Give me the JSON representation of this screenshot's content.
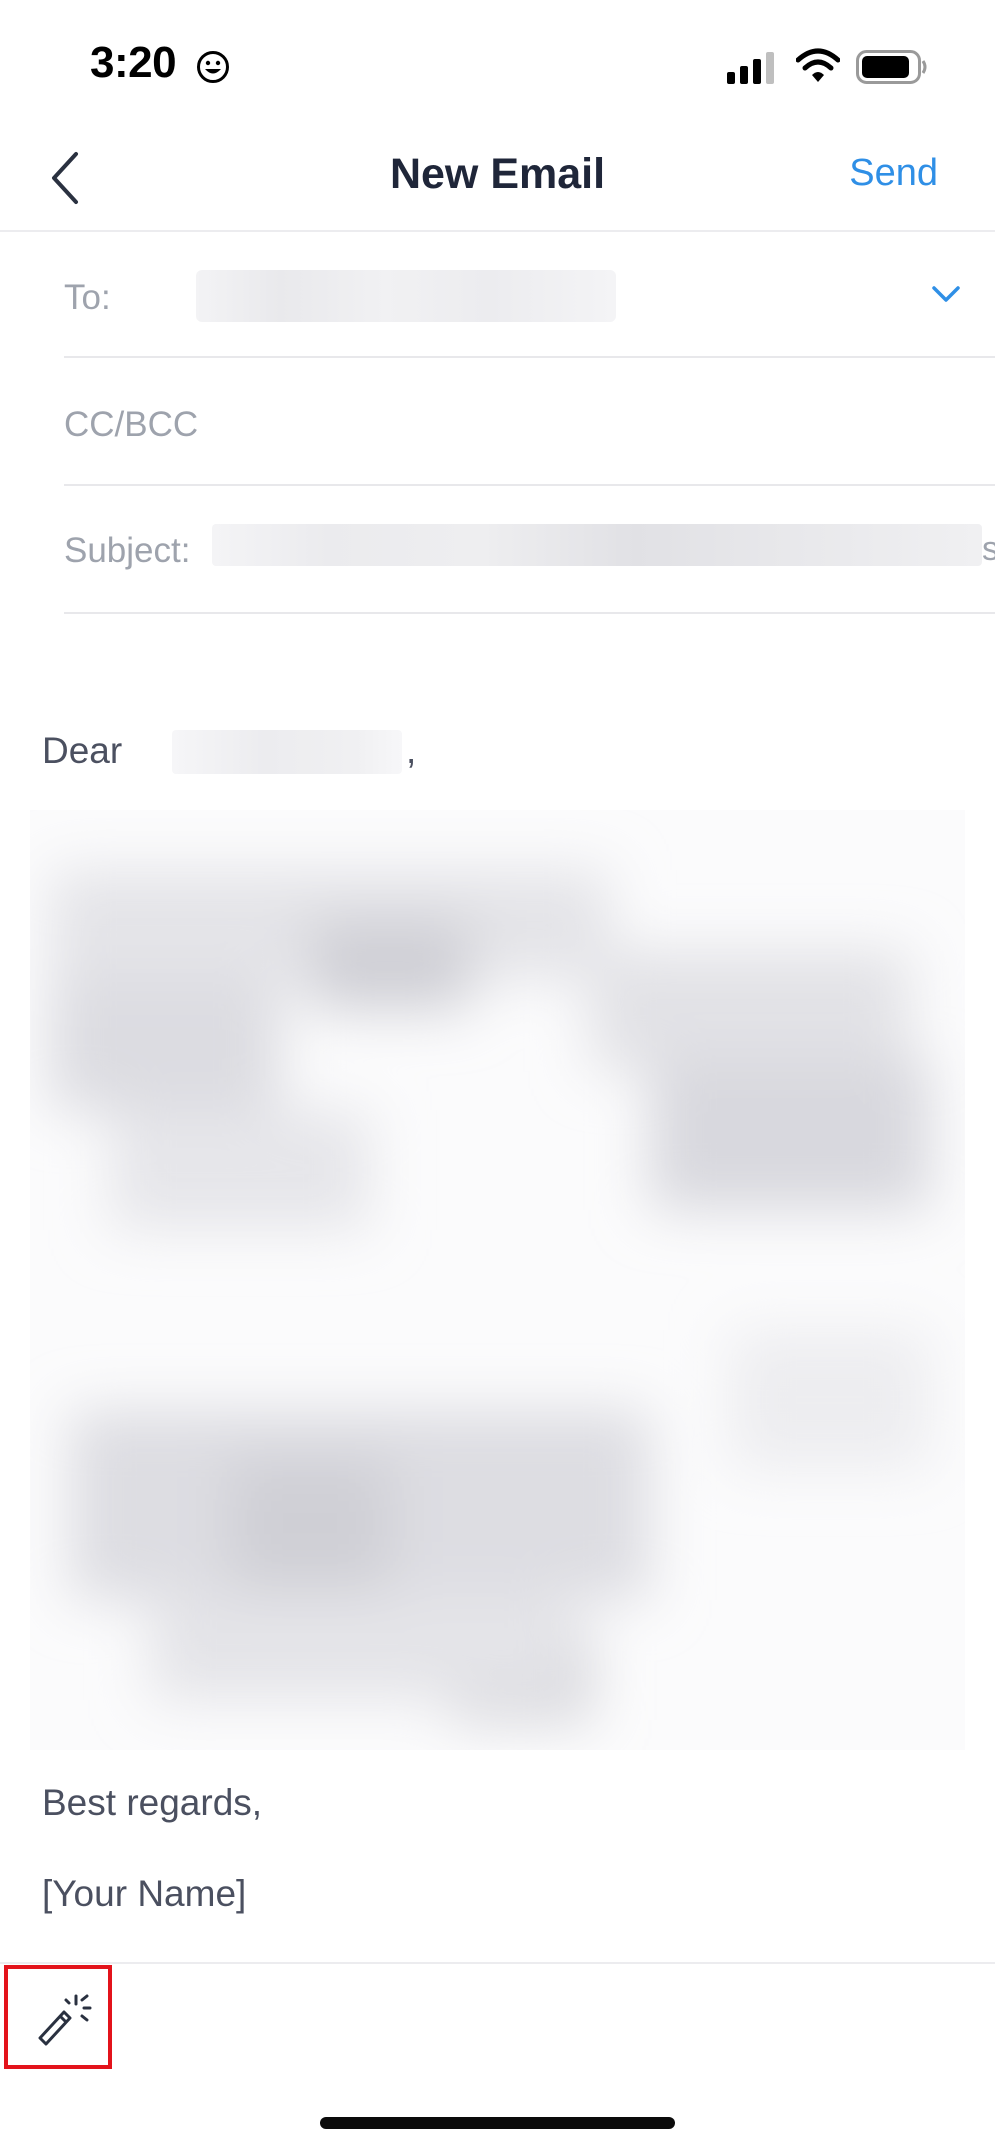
{
  "status_bar": {
    "time": "3:20",
    "emoji_icon": "smiley-face-icon"
  },
  "header": {
    "title": "New Email",
    "send_label": "Send"
  },
  "fields": {
    "to_label": "To:",
    "cc_label": "CC/BCC",
    "subject_label": "Subject:",
    "subject_overflow_char": "s"
  },
  "body": {
    "greeting": "Dear",
    "greeting_punct": ",",
    "closing": "Best regards,",
    "signature": "[Your Name]"
  },
  "toolbar": {
    "ai_tool_icon": "magic-wand-icon",
    "highlight_color": "#e3131b"
  },
  "colors": {
    "accent": "#2f8fe6",
    "title": "#1f2639"
  }
}
